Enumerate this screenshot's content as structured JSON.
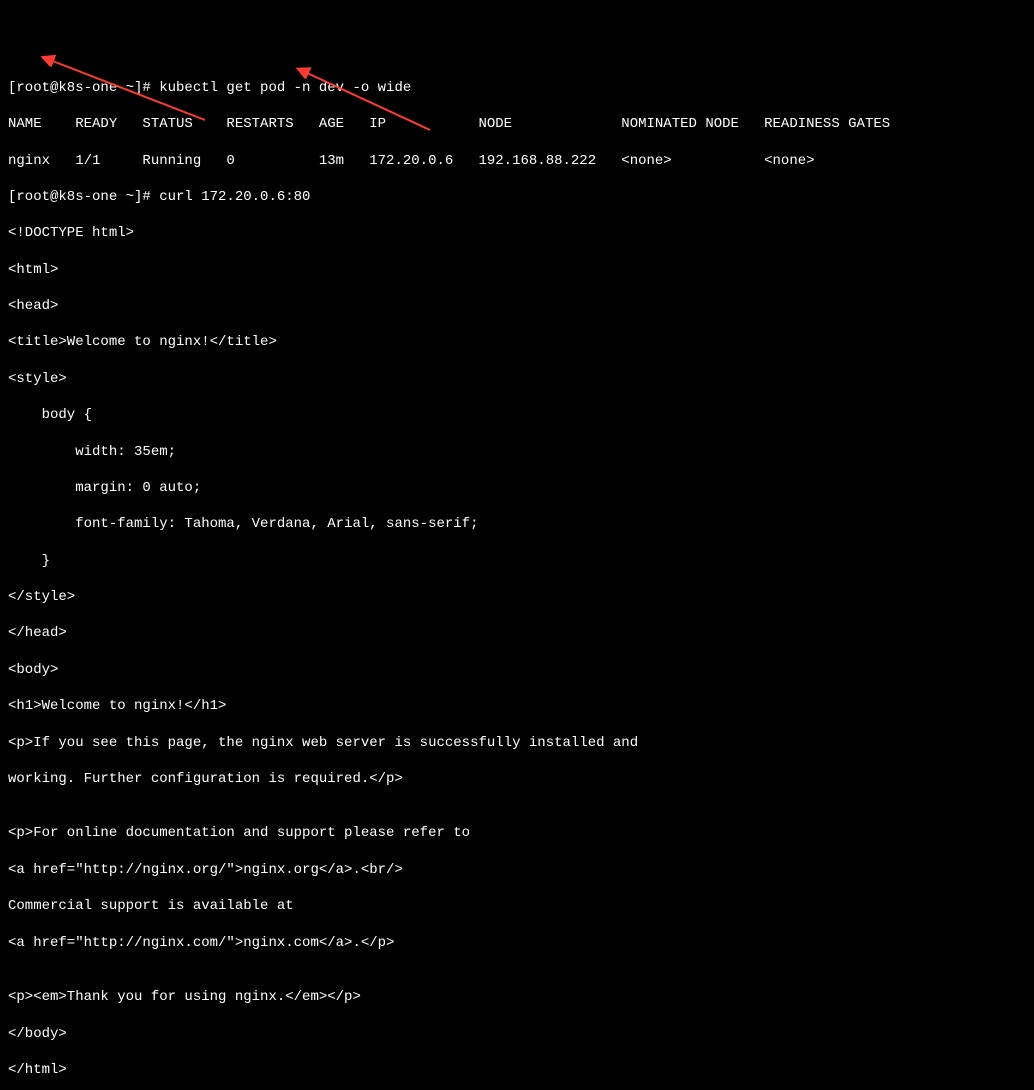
{
  "prompt1": "[root@k8s-one ~]# kubectl get pod -n dev -o wide",
  "table_headers": "NAME    READY   STATUS    RESTARTS   AGE   IP           NODE             NOMINATED NODE   READINESS GATES",
  "table_row": "nginx   1/1     Running   0          13m   172.20.0.6   192.168.88.222   <none>           <none>",
  "prompt2": "[root@k8s-one ~]# curl 172.20.0.6:80",
  "output": [
    "<!DOCTYPE html>",
    "<html>",
    "<head>",
    "<title>Welcome to nginx!</title>",
    "<style>",
    "    body {",
    "        width: 35em;",
    "        margin: 0 auto;",
    "        font-family: Tahoma, Verdana, Arial, sans-serif;",
    "    }",
    "</style>",
    "</head>",
    "<body>",
    "<h1>Welcome to nginx!</h1>",
    "<p>If you see this page, the nginx web server is successfully installed and",
    "working. Further configuration is required.</p>",
    "",
    "<p>For online documentation and support please refer to",
    "<a href=\"http://nginx.org/\">nginx.org</a>.<br/>",
    "Commercial support is available at",
    "<a href=\"http://nginx.com/\">nginx.com</a>.</p>",
    "",
    "<p><em>Thank you for using nginx.</em></p>",
    "</body>",
    "</html>"
  ]
}
